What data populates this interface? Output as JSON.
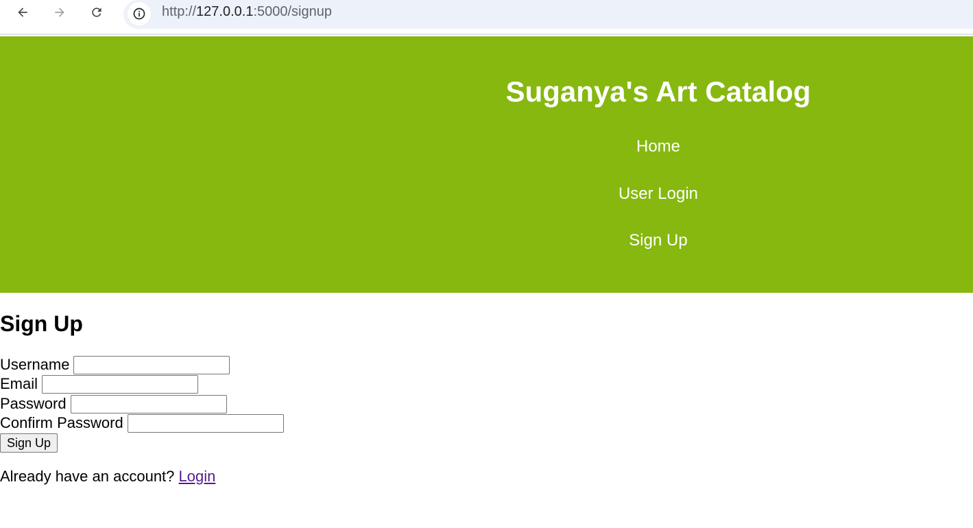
{
  "browser": {
    "url_scheme": "http://",
    "url_host": "127.0.0.1",
    "url_rest": ":5000/signup",
    "icons": [
      "back-arrow-icon",
      "forward-arrow-icon",
      "reload-icon",
      "info-icon"
    ]
  },
  "header": {
    "title": "Suganya's Art Catalog",
    "background_color": "#86b80f",
    "nav": {
      "home": "Home",
      "user_login": "User Login",
      "sign_up": "Sign Up"
    }
  },
  "main": {
    "heading": "Sign Up",
    "form": {
      "username_label": "Username",
      "email_label": "Email",
      "password_label": "Password",
      "confirm_password_label": "Confirm Password",
      "username_value": "",
      "email_value": "",
      "password_value": "",
      "confirm_password_value": "",
      "submit_label": "Sign Up"
    },
    "login_prompt": {
      "text": "Already have an account?",
      "link_label": "Login",
      "link_color": "#551a8b"
    }
  }
}
